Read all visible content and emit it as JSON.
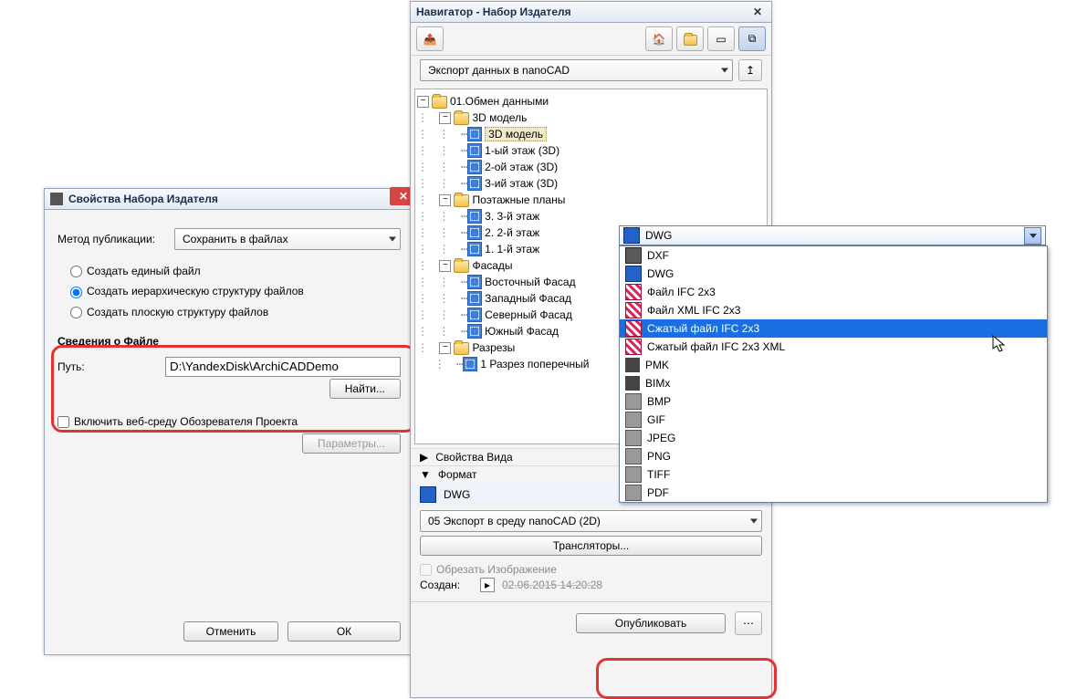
{
  "props": {
    "title": "Свойства Набора Издателя",
    "publishMethodLabel": "Метод публикации:",
    "publishMethodValue": "Сохранить в файлах",
    "radio1": "Создать единый файл",
    "radio2": "Создать иерархическую структуру файлов",
    "radio3": "Создать плоскую структуру файлов",
    "fileSectionTitle": "Сведения о Файле",
    "pathLabel": "Путь:",
    "pathValue": "D:\\YandexDisk\\ArchiCADDemo",
    "browseBtn": "Найти...",
    "includeBrowserCheck": "Включить веб-среду Обозревателя Проекта",
    "paramsBtn": "Параметры...",
    "cancelBtn": "Отменить",
    "okBtn": "ОК"
  },
  "nav": {
    "title": "Навигатор - Набор Издателя",
    "exportDrop": "Экспорт данных в nanoCAD",
    "tree": {
      "root": "01.Обмен данными",
      "g1": "3D модель",
      "g1_items": [
        "3D модель",
        "1-ый этаж (3D)",
        "2-ой этаж (3D)",
        "3-ий этаж (3D)"
      ],
      "g2": "Поэтажные планы",
      "g2_items": [
        "3. 3-й этаж",
        "2. 2-й этаж",
        "1. 1-й этаж"
      ],
      "g3": "Фасады",
      "g3_items": [
        "Восточный Фасад",
        "Западный Фасад",
        "Северный Фасад",
        "Южный Фасад"
      ],
      "g4": "Разрезы",
      "g4_items": [
        "1 Разрез поперечный"
      ]
    },
    "viewPropsLabel": "Свойства Вида",
    "formatLabel": "Формат",
    "formatValue": "DWG",
    "translatorDrop": "05 Экспорт в среду nanoCAD (2D)",
    "translatorsBtn": "Трансляторы...",
    "cropCheck": "Обрезать Изображение",
    "createdLabel": "Создан:",
    "createdValue": "02.06.2015 14:20:28",
    "publishBtn": "Опубликовать"
  },
  "ddlist": {
    "selected": "DWG",
    "items": [
      "DXF",
      "DWG",
      "Файл IFC 2x3",
      "Файл XML IFC 2x3",
      "Сжатый файл IFC 2x3",
      "Сжатый файл IFC 2x3 XML",
      "PMK",
      "BIMx",
      "BMP",
      "GIF",
      "JPEG",
      "PNG",
      "TIFF",
      "PDF"
    ],
    "highlightIndex": 4
  }
}
